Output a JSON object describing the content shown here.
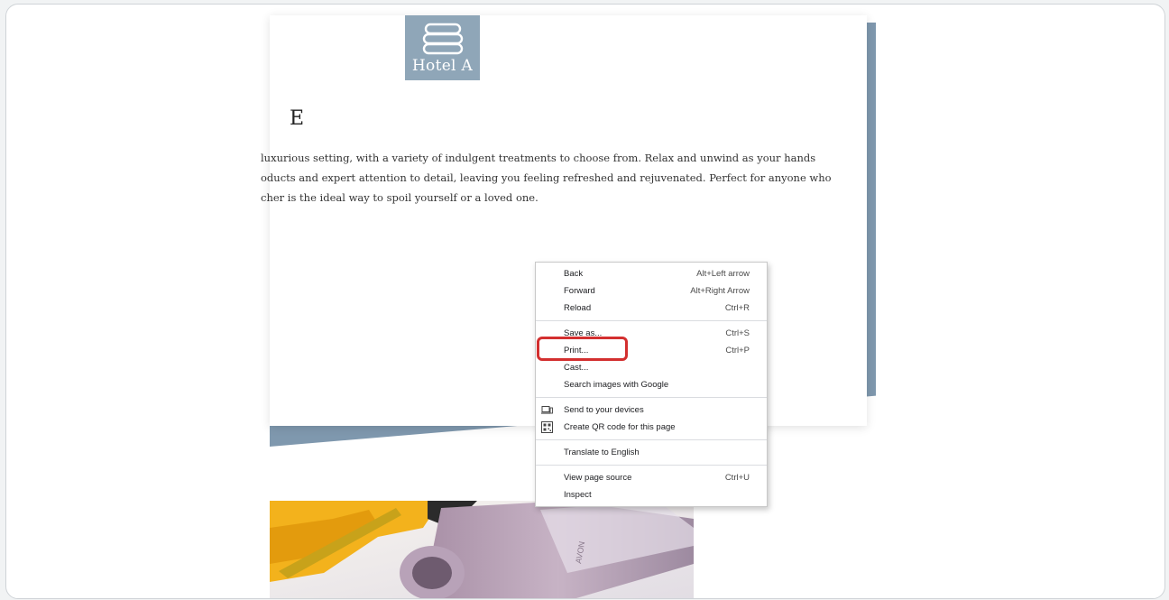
{
  "page": {
    "logo_text": "Hotel A",
    "heading_fragment": "E",
    "description_lines": [
      "luxurious setting, with a variety of indulgent treatments to choose from. Relax and unwind as your hands",
      "oducts and expert attention to detail, leaving you feeling refreshed and rejuvenated. Perfect for anyone who",
      "cher is the ideal way to spoil yourself or a loved one."
    ],
    "photo_brand_text": "AVON"
  },
  "context_menu": {
    "back": {
      "label": "Back",
      "shortcut": "Alt+Left arrow"
    },
    "forward": {
      "label": "Forward",
      "shortcut": "Alt+Right Arrow"
    },
    "reload": {
      "label": "Reload",
      "shortcut": "Ctrl+R"
    },
    "save_as": {
      "label": "Save as...",
      "shortcut": "Ctrl+S"
    },
    "print": {
      "label": "Print...",
      "shortcut": "Ctrl+P"
    },
    "cast": {
      "label": "Cast..."
    },
    "search_images": {
      "label": "Search images with Google"
    },
    "send_devices": {
      "label": "Send to your devices",
      "icon": "laptop-icon"
    },
    "qr_code": {
      "label": "Create QR code for this page",
      "icon": "qr-code-icon"
    },
    "translate": {
      "label": "Translate to English"
    },
    "view_source": {
      "label": "View page source",
      "shortcut": "Ctrl+U"
    },
    "inspect": {
      "label": "Inspect"
    }
  },
  "colors": {
    "highlight": "#d32f2f",
    "logo_bg": "#8fa6b8",
    "blue_shape": "#7f98ae"
  }
}
